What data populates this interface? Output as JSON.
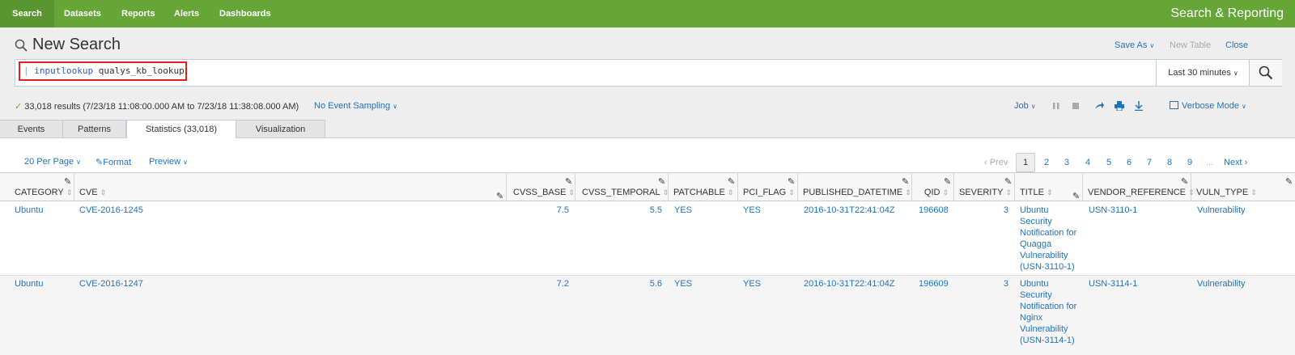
{
  "nav": {
    "items": [
      "Search",
      "Datasets",
      "Reports",
      "Alerts",
      "Dashboards"
    ],
    "app_title": "Search & Reporting"
  },
  "header": {
    "title": "New Search",
    "save_as": "Save As",
    "new_table": "New Table",
    "close": "Close"
  },
  "search": {
    "pipe": "|",
    "command": "inputlookup",
    "argument": "qualys_kb_lookup",
    "time_range": "Last 30 minutes"
  },
  "status": {
    "results": "33,018 results (7/23/18 11:08:00.000 AM to 7/23/18 11:38:08.000 AM)",
    "sampling": "No Event Sampling",
    "job": "Job",
    "mode": "Verbose Mode"
  },
  "tabs": [
    "Events",
    "Patterns",
    "Statistics (33,018)",
    "Visualization"
  ],
  "controls": {
    "per_page": "20 Per Page",
    "format": "Format",
    "preview": "Preview"
  },
  "pager": {
    "prev": "Prev",
    "pages": [
      "1",
      "2",
      "3",
      "4",
      "5",
      "6",
      "7",
      "8",
      "9"
    ],
    "ellipsis": "...",
    "next": "Next"
  },
  "table": {
    "columns": [
      "CATEGORY",
      "CVE",
      "CVSS_BASE",
      "CVSS_TEMPORAL",
      "PATCHABLE",
      "PCI_FLAG",
      "PUBLISHED_DATETIME",
      "QID",
      "SEVERITY",
      "TITLE",
      "VENDOR_REFERENCE",
      "VULN_TYPE"
    ],
    "rows": [
      {
        "category": "Ubuntu",
        "cve": "CVE-2016-1245",
        "cvss_base": "7.5",
        "cvss_temporal": "5.5",
        "patchable": "YES",
        "pci_flag": "YES",
        "published": "2016-10-31T22:41:04Z",
        "qid": "196608",
        "severity": "3",
        "title": "Ubuntu Security Notification for Quagga Vulnerability (USN-3110-1)",
        "vendor_reference": "USN-3110-1",
        "vuln_type": "Vulnerability"
      },
      {
        "category": "Ubuntu",
        "cve": "CVE-2016-1247",
        "cvss_base": "7.2",
        "cvss_temporal": "5.6",
        "patchable": "YES",
        "pci_flag": "YES",
        "published": "2016-10-31T22:41:04Z",
        "qid": "196609",
        "severity": "3",
        "title": "Ubuntu Security Notification for Nginx Vulnerability (USN-3114-1)",
        "vendor_reference": "USN-3114-1",
        "vuln_type": "Vulnerability"
      }
    ]
  },
  "colors": {
    "nav_bg": "#65a637",
    "link": "#1e73be",
    "highlight_border": "#e02020"
  }
}
